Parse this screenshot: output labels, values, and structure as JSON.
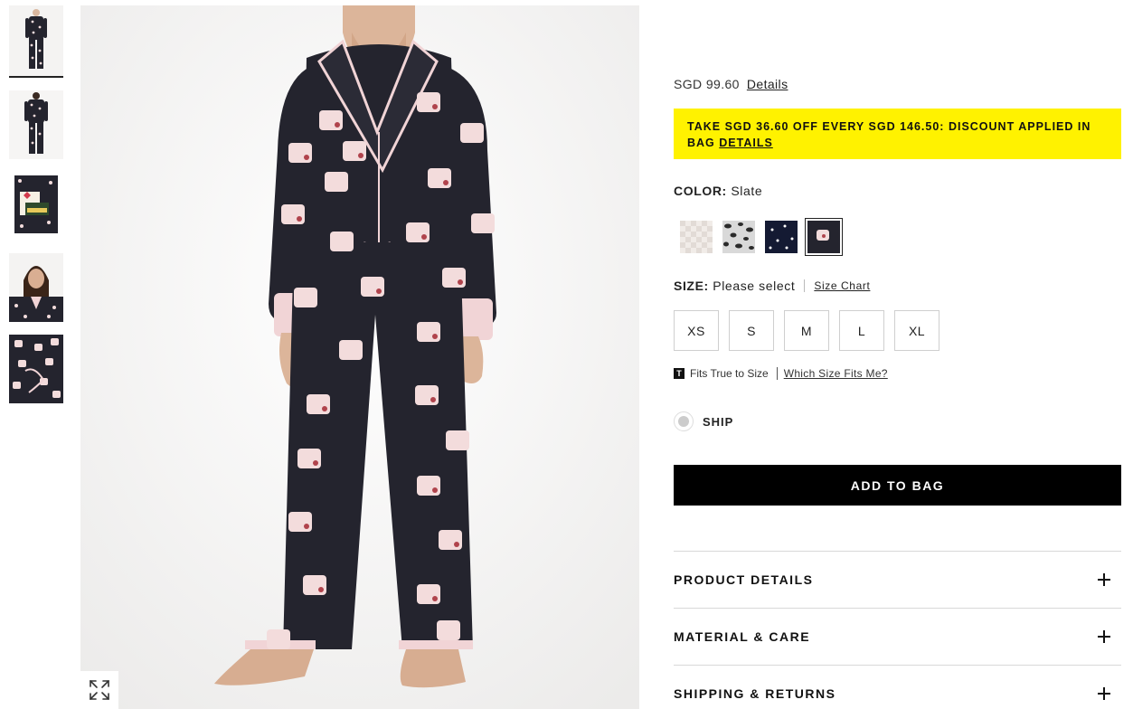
{
  "thumbnails": [
    {
      "label": "pajama set front view"
    },
    {
      "label": "pajama set back view"
    },
    {
      "label": "packaged pajama set"
    },
    {
      "label": "pajama top close-up"
    },
    {
      "label": "fabric print detail"
    }
  ],
  "price": {
    "amount": "SGD 99.60",
    "details_label": "Details"
  },
  "promo": {
    "text": "TAKE SGD 36.60 OFF EVERY SGD 146.50: DISCOUNT APPLIED IN BAG",
    "link": "DETAILS"
  },
  "color": {
    "label": "COLOR:",
    "value": "Slate",
    "swatches": [
      "Ivory houndstooth",
      "Leopard",
      "Navy dot",
      "Slate"
    ]
  },
  "size": {
    "label": "SIZE:",
    "value": "Please select",
    "chart_link": "Size Chart",
    "options": [
      "XS",
      "S",
      "M",
      "L",
      "XL"
    ]
  },
  "fit": {
    "icon_letter": "T",
    "text": "Fits True to Size",
    "link": "Which Size Fits Me?"
  },
  "ship": {
    "label": "SHIP"
  },
  "add_to_bag": "ADD TO BAG",
  "accordions": [
    {
      "label": "PRODUCT DETAILS"
    },
    {
      "label": "MATERIAL & CARE"
    },
    {
      "label": "SHIPPING & RETURNS"
    }
  ],
  "colors": {
    "promo_bg": "#fff200",
    "button_bg": "#000000",
    "pajama": "#24242e",
    "mug": "#f3dcdc",
    "trim": "#f1d4d6"
  }
}
